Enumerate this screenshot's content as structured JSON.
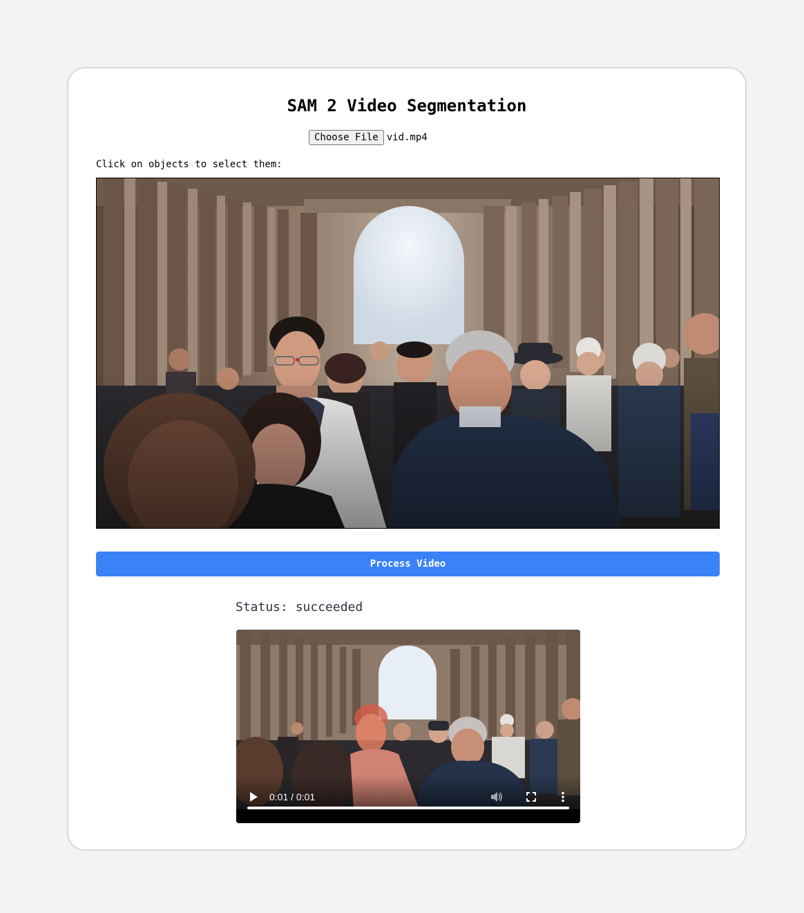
{
  "header": {
    "title": "SAM 2 Video Segmentation"
  },
  "file_input": {
    "button_label": "Choose File",
    "file_name": "vid.mp4"
  },
  "instruction": "Click on objects to select them:",
  "process_button": {
    "label": "Process Video"
  },
  "status": {
    "text": "Status: succeeded"
  },
  "video_player": {
    "time_display": "0:01 / 0:01",
    "progress": 1.0,
    "icons": [
      "play-icon",
      "volume-icon",
      "fullscreen-icon",
      "more-options-icon"
    ]
  },
  "colors": {
    "accent": "#3b82f6",
    "selection_point": "#e11d1d",
    "mask_overlay": "#ff7a6a"
  }
}
